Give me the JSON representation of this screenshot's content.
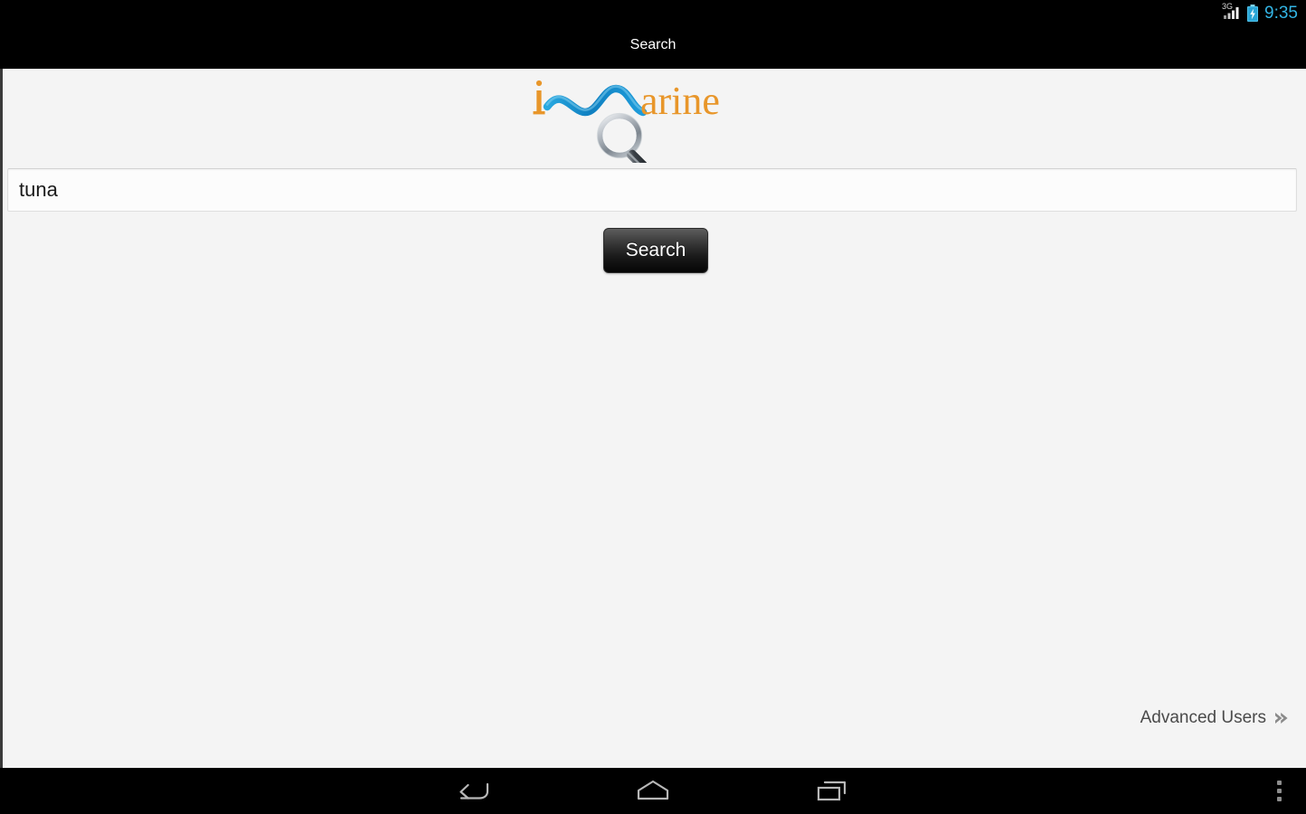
{
  "status_bar": {
    "network_label": "3G",
    "signal_icon": "signal-bars-icon",
    "battery_icon": "battery-charging-icon",
    "time": "9:35",
    "time_color": "#33b5e5"
  },
  "title_bar": {
    "title": "Search"
  },
  "logo": {
    "name": "imarine-logo",
    "letter_i": "i",
    "wave_icon": "blue-wave-icon",
    "word": "arine",
    "magnifier_icon": "magnifying-glass-icon",
    "text_color": "#e8962a",
    "wave_color": "#1a9ad6"
  },
  "search": {
    "input_name": "search-input",
    "value": "tuna",
    "placeholder": "",
    "button_label": "Search"
  },
  "footer": {
    "advanced_users_label": "Advanced Users",
    "advanced_users_icon": "double-chevron-right-icon"
  },
  "nav_bar": {
    "back_icon": "back-arrow-icon",
    "home_icon": "home-icon",
    "recents_icon": "recent-apps-icon",
    "overflow_icon": "overflow-menu-icon"
  }
}
